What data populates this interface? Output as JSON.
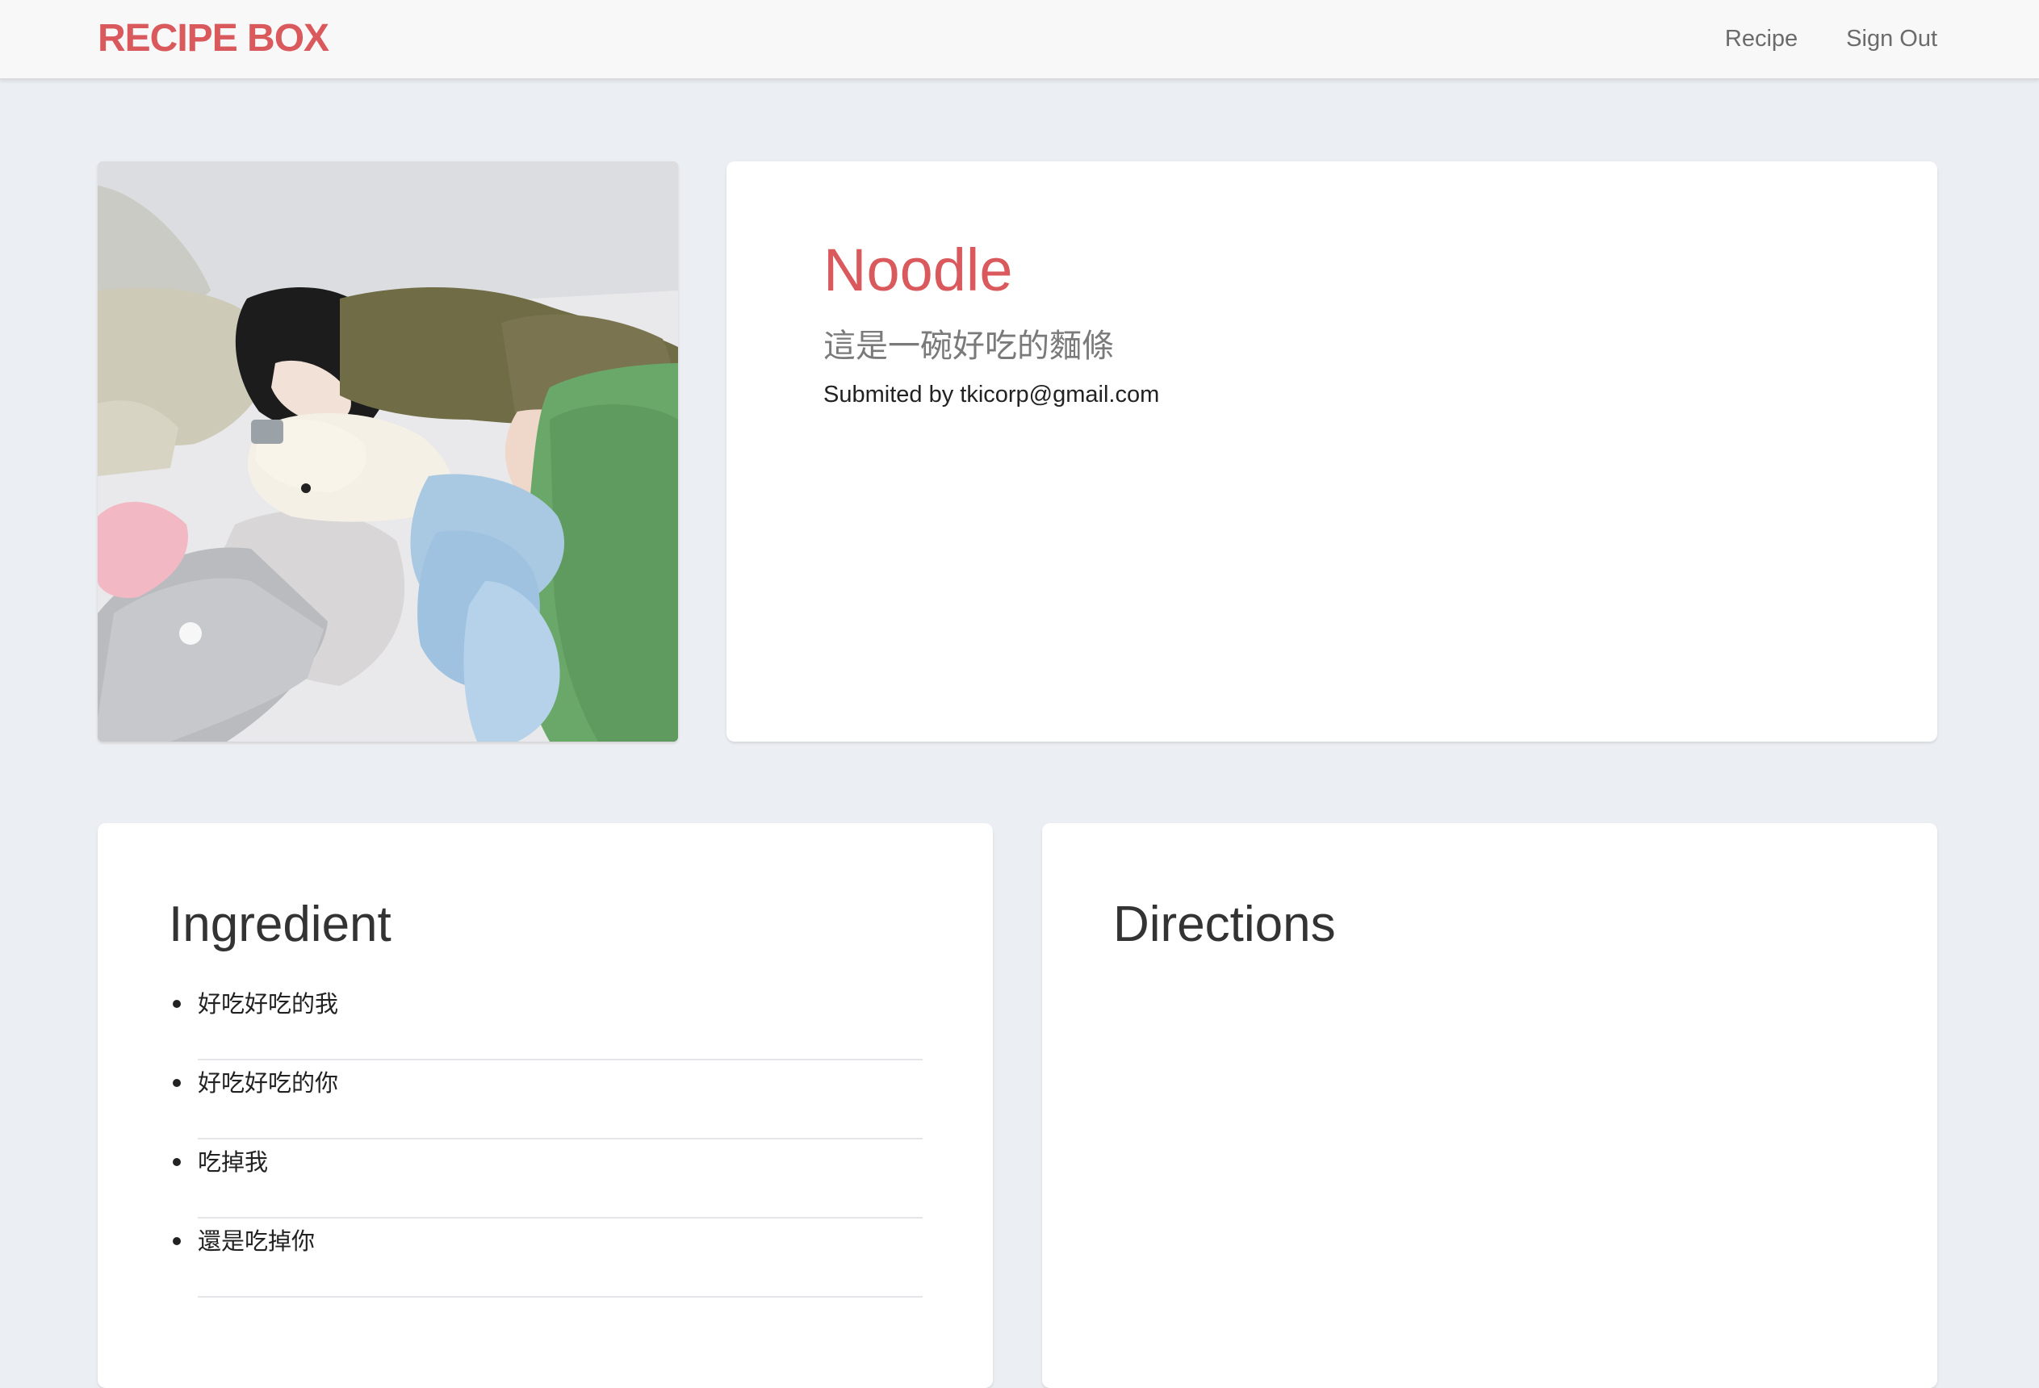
{
  "navbar": {
    "brand": "RECIPE BOX",
    "links": [
      "Recipe",
      "Sign Out"
    ]
  },
  "recipe": {
    "title": "Noodle",
    "description": "這是一碗好吃的麵條",
    "submitted_by": "Submited by tkicorp@gmail.com"
  },
  "ingredients": {
    "title": "Ingredient",
    "items": [
      "好吃好吃的我",
      "好吃好吃的你",
      "吃掉我",
      "還是吃掉你"
    ]
  },
  "directions": {
    "title": "Directions"
  },
  "colors": {
    "accent": "#d9595c",
    "background": "#ebeef2",
    "card": "#ffffff",
    "navbar": "#f8f8f8"
  }
}
